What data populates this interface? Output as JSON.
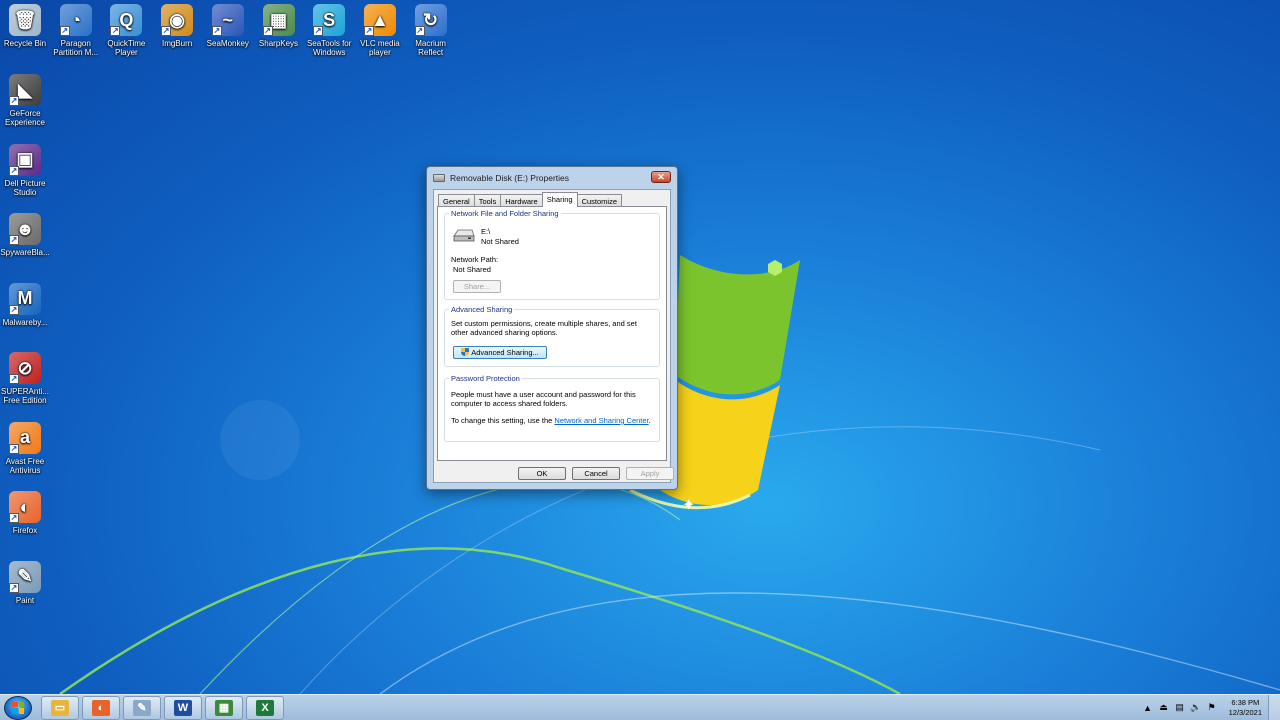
{
  "desktop": {
    "icons": [
      {
        "label": "Recycle Bin",
        "glyph": "🗑",
        "color": "#9fb6c9"
      },
      {
        "label": "Paragon Partition M...",
        "glyph": "◔",
        "color": "#2a70c8"
      },
      {
        "label": "QuickTime Player",
        "glyph": "Q",
        "color": "#3a8fd6"
      },
      {
        "label": "ImgBurn",
        "glyph": "◉",
        "color": "#d08a1c"
      },
      {
        "label": "SeaMonkey",
        "glyph": "~",
        "color": "#2a55b8"
      },
      {
        "label": "SharpKeys",
        "glyph": "▦",
        "color": "#4c8a4c"
      },
      {
        "label": "SeaTools for Windows",
        "glyph": "S",
        "color": "#1aa5d8"
      },
      {
        "label": "VLC media player",
        "glyph": "▲",
        "color": "#f08a00"
      },
      {
        "label": "Macrium Reflect",
        "glyph": "↻",
        "color": "#2b6fd0"
      },
      {
        "label": "GeForce Experience",
        "glyph": "◣",
        "color": "#3c3c3c"
      },
      {
        "label": "Dell Picture Studio",
        "glyph": "▣",
        "color": "#5a2a8a"
      },
      {
        "label": "SpywareBla...",
        "glyph": "☻",
        "color": "#6a6a6a"
      },
      {
        "label": "Malwareby...",
        "glyph": "M",
        "color": "#1565c0"
      },
      {
        "label": "SUPERAnti... Free Edition",
        "glyph": "⊘",
        "color": "#c02020"
      },
      {
        "label": "Avast Free Antivirus",
        "glyph": "a",
        "color": "#f07a18"
      },
      {
        "label": "Firefox",
        "glyph": "◐",
        "color": "#e8632a"
      },
      {
        "label": "Paint",
        "glyph": "✎",
        "color": "#7a9ab8"
      }
    ]
  },
  "dialog": {
    "title": "Removable Disk (E:) Properties",
    "close_label": "✕",
    "tabs": [
      "General",
      "Tools",
      "Hardware",
      "Sharing",
      "Customize"
    ],
    "active_tab": "Sharing",
    "network_sharing": {
      "title": "Network File and Folder Sharing",
      "drive_name": "E:\\",
      "drive_status": "Not Shared",
      "path_label": "Network Path:",
      "path_value": "Not Shared",
      "share_button": "Share..."
    },
    "advanced_sharing": {
      "title": "Advanced Sharing",
      "description": "Set custom permissions, create multiple shares, and set other advanced sharing options.",
      "button": "Advanced Sharing..."
    },
    "password_protection": {
      "title": "Password Protection",
      "description": "People must have a user account and password for this computer to access shared folders.",
      "change_prefix": "To change this setting, use the ",
      "link": "Network and Sharing Center",
      "change_suffix": "."
    },
    "buttons": {
      "ok": "OK",
      "cancel": "Cancel",
      "apply": "Apply"
    }
  },
  "taskbar": {
    "apps": [
      {
        "name": "explorer",
        "glyph": "▭",
        "color": "#e8b43c"
      },
      {
        "name": "firefox",
        "glyph": "◐",
        "color": "#e8632a"
      },
      {
        "name": "paint",
        "glyph": "✎",
        "color": "#8aa8c8"
      },
      {
        "name": "word",
        "glyph": "W",
        "color": "#1f4e9e"
      },
      {
        "name": "app-grid",
        "glyph": "▦",
        "color": "#3a8a3a"
      },
      {
        "name": "excel",
        "glyph": "X",
        "color": "#1d7a3a"
      }
    ],
    "time": "6:38 PM",
    "date": "12/3/2021"
  }
}
